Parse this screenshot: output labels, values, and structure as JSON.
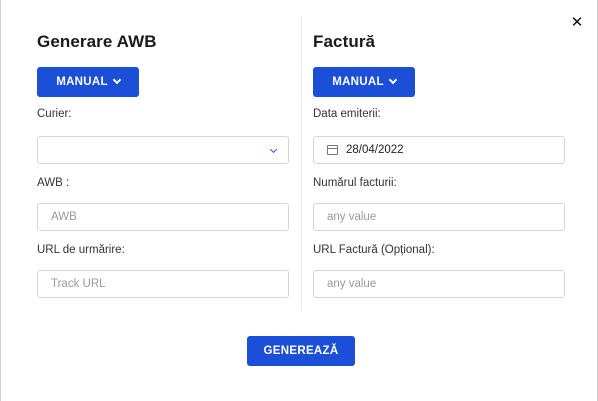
{
  "dialog": {
    "close_glyph": "✕"
  },
  "awb_section": {
    "title": "Generare AWB",
    "mode_label": "MANUAL",
    "courier_label": "Curier:",
    "courier_value": "",
    "awb_label": "AWB :",
    "awb_placeholder": "AWB",
    "tracking_label": "URL de urmărire:",
    "tracking_placeholder": "Track URL"
  },
  "invoice_section": {
    "title": "Factură",
    "mode_label": "MANUAL",
    "issue_date_label": "Data emiterii:",
    "issue_date_value": "28/04/2022",
    "invoice_number_label": "Numărul facturii:",
    "invoice_number_placeholder": "any value",
    "invoice_url_label": "URL Factură (Opțional):",
    "invoice_url_placeholder": "any value"
  },
  "footer": {
    "generate_label": "GENEREAZĂ"
  },
  "colors": {
    "accent": "#1b4fd8"
  }
}
